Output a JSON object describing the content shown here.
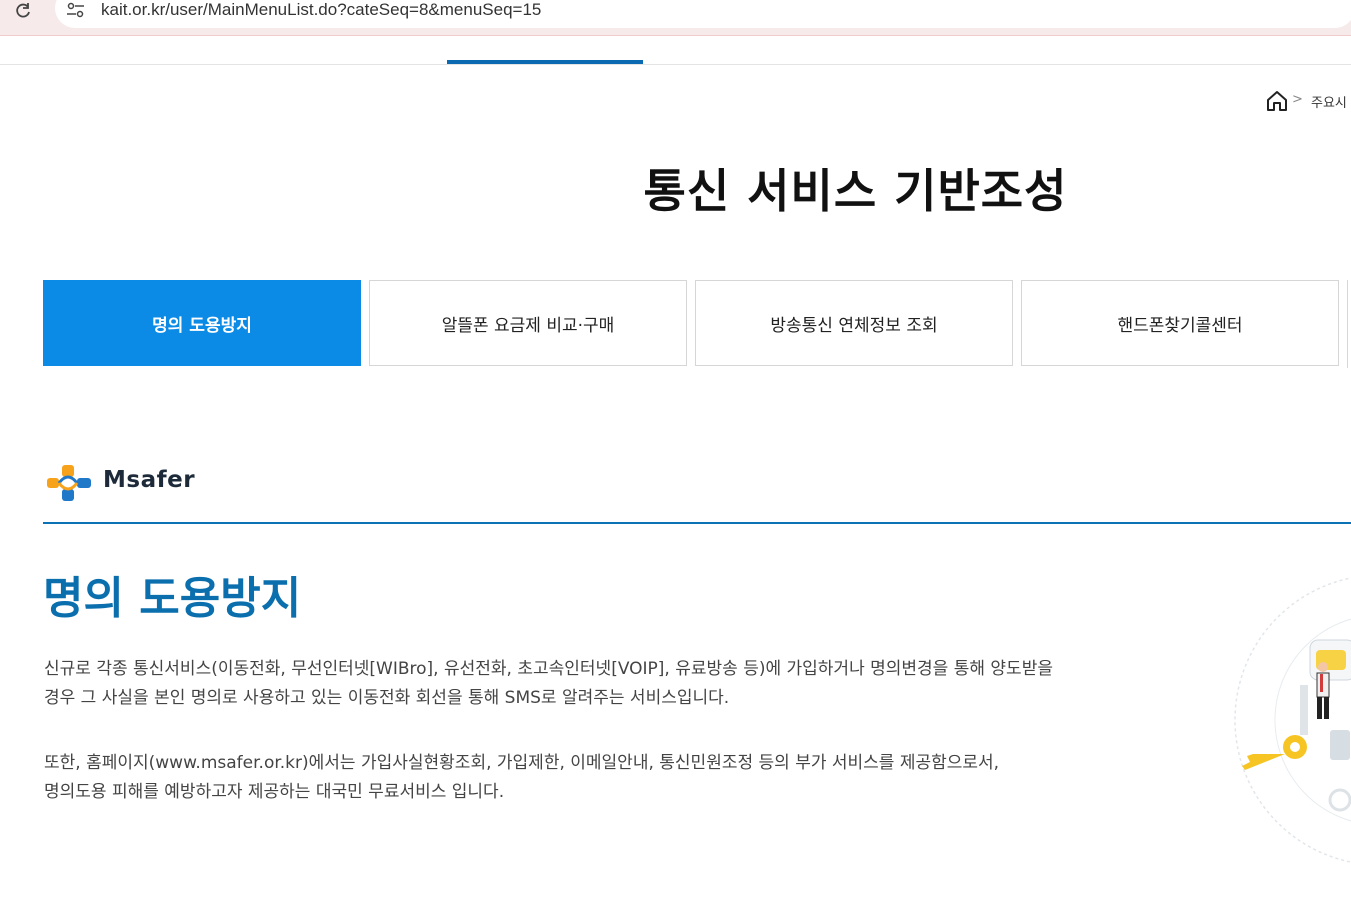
{
  "browser": {
    "url": "kait.or.kr/user/MainMenuList.do?cateSeq=8&menuSeq=15"
  },
  "breadcrumb": {
    "current": "주요시"
  },
  "page": {
    "title": "통신 서비스 기반조성"
  },
  "tabs": [
    {
      "label": "명의 도용방지",
      "active": true
    },
    {
      "label": "알뜰폰 요금제 비교·구매",
      "active": false
    },
    {
      "label": "방송통신 연체정보 조회",
      "active": false
    },
    {
      "label": "핸드폰찾기콜센터",
      "active": false
    }
  ],
  "section": {
    "logo_text": "Msafer",
    "title": "명의 도용방지",
    "paragraph1": [
      "신규로 각종 통신서비스(이동전화, 무선인터넷[WIBro], 유선전화, 초고속인터넷[VOIP], 유료방송 등)에 가입하거나 명의변경을 통해 양도받을",
      "경우 그 사실을 본인 명의로 사용하고 있는 이동전화 회선을 통해 SMS로 알려주는 서비스입니다."
    ],
    "paragraph2": [
      "또한, 홈페이지(www.msafer.or.kr)에서는 가입사실현황조회, 가입제한, 이메일안내, 통신민원조정 등의 부가 서비스를 제공함으로서,",
      "명의도용 피해를 예방하고자 제공하는 대국민 무료서비스 입니다."
    ]
  },
  "colors": {
    "accent": "#0b8ae6",
    "title_blue": "#0b6fae",
    "nav_active": "#0b6ab1"
  },
  "icons": [
    "reload-icon",
    "site-info-icon",
    "home-icon",
    "chevron-right-icon",
    "msafer-logo-mark",
    "security-illustration"
  ]
}
